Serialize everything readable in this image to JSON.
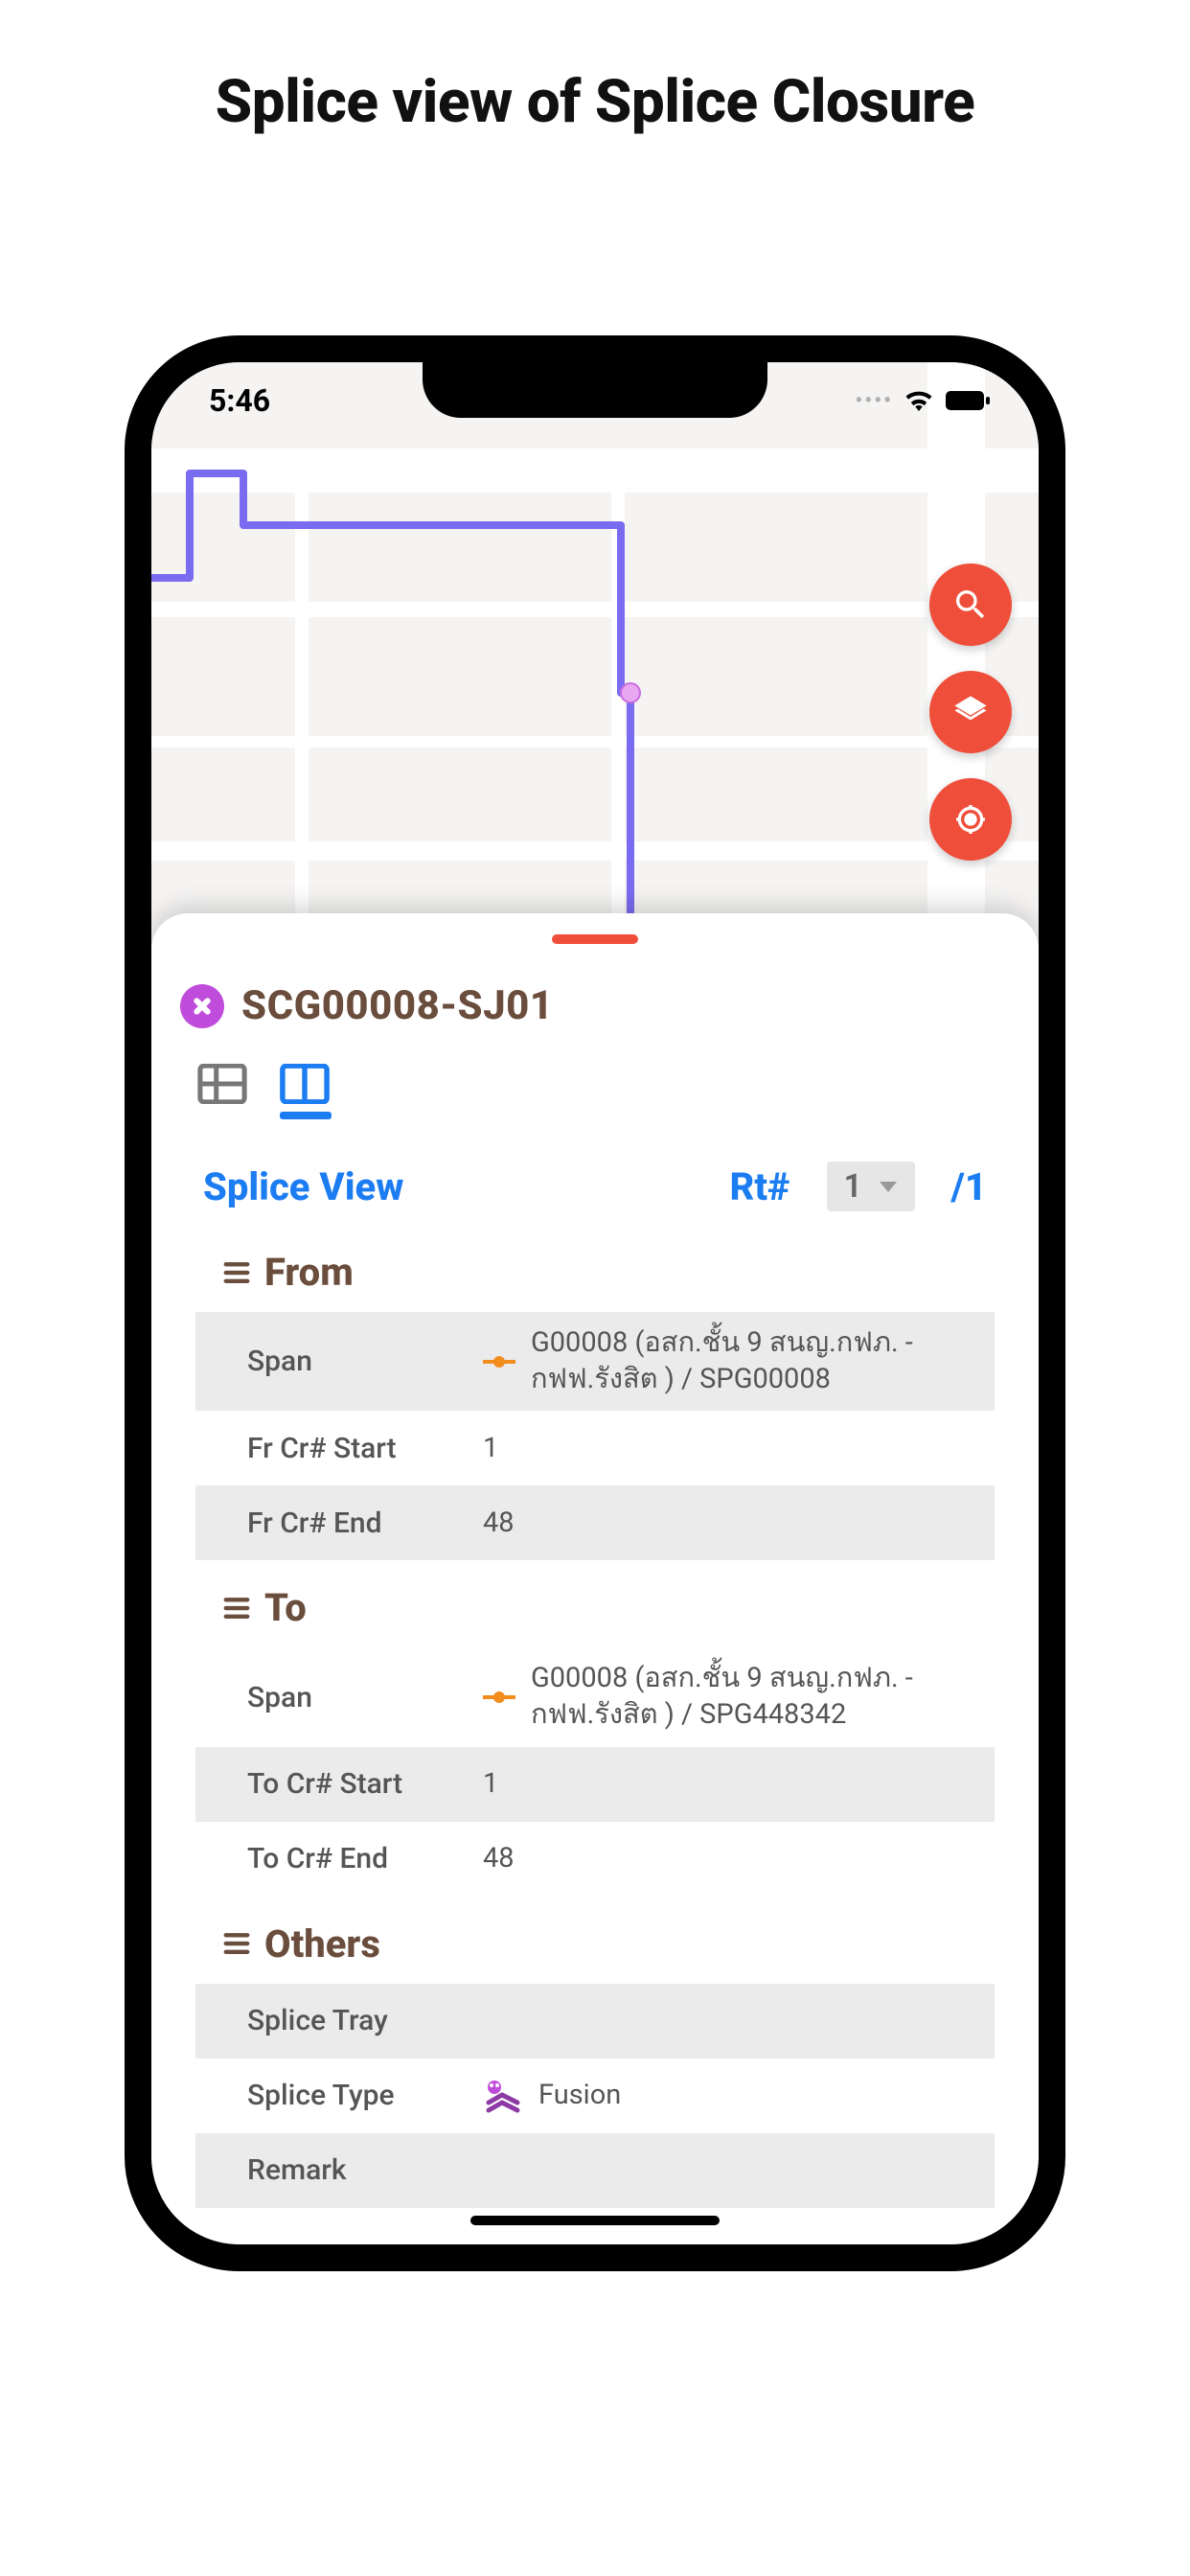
{
  "page": {
    "title": "Splice view of Splice Closure"
  },
  "status_bar": {
    "time": "5:46"
  },
  "fabs": [
    {
      "name": "search-icon"
    },
    {
      "name": "layers-icon"
    },
    {
      "name": "locate-icon"
    }
  ],
  "sheet": {
    "closure_id": "SCG00008-SJ01",
    "view_title": "Splice View",
    "rt": {
      "label": "Rt#",
      "selected": "1",
      "total": "/1"
    },
    "sections": {
      "from": {
        "title": "From",
        "span_label": "Span",
        "span_value": "G00008 (อสก.ชั้น 9 สนญ.กฟภ. - กฟฟ.รังสิต ) / SPG00008",
        "start_label": "Fr Cr# Start",
        "start_value": "1",
        "end_label": "Fr Cr# End",
        "end_value": "48"
      },
      "to": {
        "title": "To",
        "span_label": "Span",
        "span_value": "G00008 (อสก.ชั้น 9 สนญ.กฟภ. - กฟฟ.รังสิต ) / SPG448342",
        "start_label": "To Cr# Start",
        "start_value": "1",
        "end_label": "To Cr# End",
        "end_value": "48"
      },
      "others": {
        "title": "Others",
        "tray_label": "Splice Tray",
        "tray_value": "",
        "type_label": "Splice Type",
        "type_value": "Fusion",
        "remark_label": "Remark",
        "remark_value": ""
      }
    }
  },
  "colors": {
    "accent_orange": "#ef4e3a",
    "accent_blue": "#1c7cf2",
    "brown": "#6a4d3c"
  }
}
